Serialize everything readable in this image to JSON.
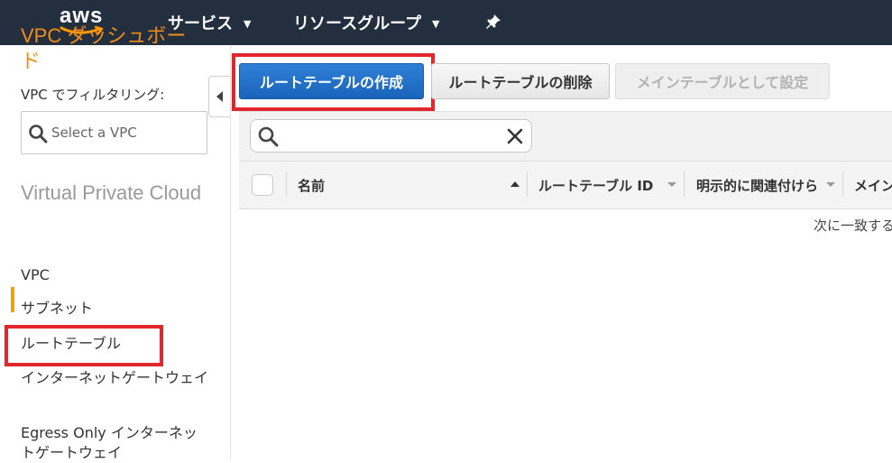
{
  "topbar": {
    "logo": "aws",
    "services_label": "サービス",
    "resource_groups_label": "リソースグループ",
    "chevron": "⌄",
    "pin_icon": "pin-icon"
  },
  "sidebar": {
    "title": "VPC ダッシュボード",
    "filter_label": "VPC でフィルタリング:",
    "vpc_select_placeholder": "Select a VPC",
    "section_title": "Virtual Private Cloud",
    "items": [
      {
        "label": "VPC"
      },
      {
        "label": "サブネット"
      },
      {
        "label": "ルートテーブル",
        "active": true
      },
      {
        "label": "インターネットゲートウェイ"
      },
      {
        "label": "Egress Only インターネットゲートウェイ"
      }
    ]
  },
  "toolbar": {
    "create_label": "ルートテーブルの作成",
    "delete_label": "ルートテーブルの削除",
    "set_main_label": "メインテーブルとして設定"
  },
  "search": {
    "placeholder": ""
  },
  "table": {
    "columns": [
      {
        "label": "名前"
      },
      {
        "label": "ルートテーブル ID"
      },
      {
        "label": "明示的に関連付けら"
      },
      {
        "label": "メイン"
      }
    ],
    "empty_message": "次に一致する"
  },
  "colors": {
    "nav_bg": "#232f3e",
    "accent_orange": "#f08d1a",
    "primary_blue": "#1a64bb",
    "highlight_red": "#e3262c"
  }
}
